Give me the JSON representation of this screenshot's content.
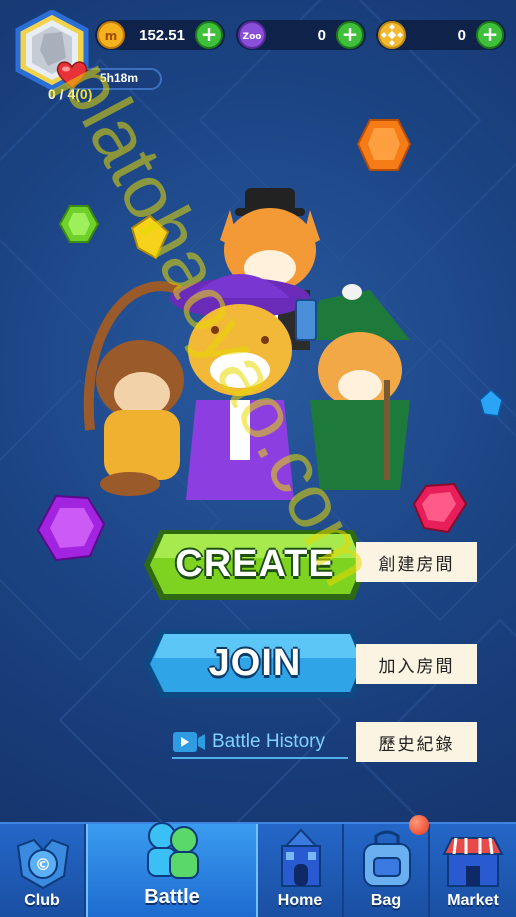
{
  "currencies": [
    {
      "name": "coin",
      "amount": "152.51",
      "icon": "coin-icon"
    },
    {
      "name": "zoo-token",
      "amount": "0",
      "icon": "zoo-token-icon",
      "icon_text": "Zoo"
    },
    {
      "name": "bnb",
      "amount": "0",
      "icon": "bnb-icon"
    }
  ],
  "energy": {
    "timer": "5h18m",
    "lives_current": "0 / 4",
    "lives_bonus_open": "(",
    "lives_bonus": "0",
    "lives_bonus_close": ")"
  },
  "actions": {
    "create_label": "CREATE",
    "create_note": "創建房間",
    "join_label": "JOIN",
    "join_note": "加入房間",
    "history_label": "Battle History",
    "history_note": "歷史紀錄"
  },
  "nav": [
    {
      "label": "Club",
      "icon": "club-icon"
    },
    {
      "label": "Battle",
      "icon": "battle-icon",
      "active": true
    },
    {
      "label": "Home",
      "icon": "home-icon"
    },
    {
      "label": "Bag",
      "icon": "bag-icon"
    },
    {
      "label": "Market",
      "icon": "market-icon"
    }
  ],
  "watermark": "platohaoyao.com",
  "colors": {
    "background": "#1b4484",
    "create_button": "#7ed321",
    "join_button": "#2fa4e7",
    "nav_bar": "#2467c8",
    "plus_button": "#3fbf3a"
  }
}
